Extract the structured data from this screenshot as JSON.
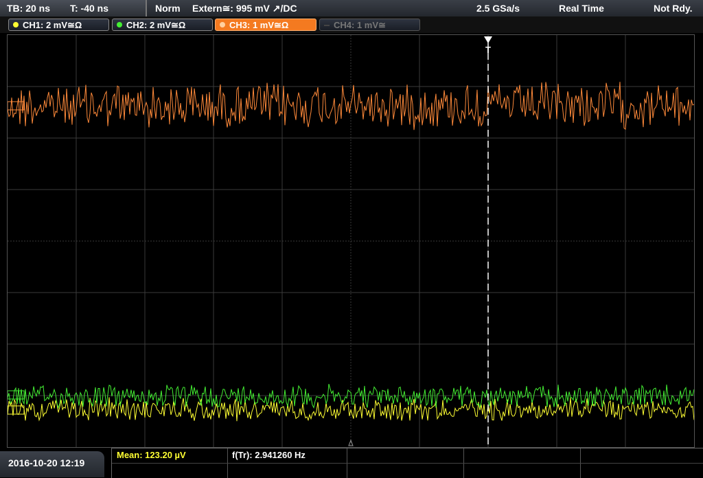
{
  "topbar": {
    "timebase": "TB: 20 ns",
    "trigger_pos": "T: -40 ns",
    "mode": "Norm",
    "trigger_source": "Extern≅: 995 mV ↗/DC",
    "sample_rate": "2.5 GSa/s",
    "acq_mode": "Real Time",
    "status": "Not Rdy."
  },
  "channels": [
    {
      "label": "CH1: 2 mV≅Ω",
      "color": "#ffff33"
    },
    {
      "label": "CH2: 2 mV≅Ω",
      "color": "#44ee33"
    },
    {
      "label": "CH3: 1 mV≅Ω",
      "color": "#ff8a3a"
    },
    {
      "label": "CH4: 1 mV≅",
      "color": "#666666"
    }
  ],
  "measurements": {
    "mean_label": "Mean: 123.20 µV",
    "freq_label": "f(Tr): 2.941260 Hz"
  },
  "footer": {
    "datetime": "2016-10-20 12:19"
  },
  "trigger_marker": "T",
  "colors": {
    "grid": "#3a3a3a",
    "trigger_line": "#ffffff"
  }
}
